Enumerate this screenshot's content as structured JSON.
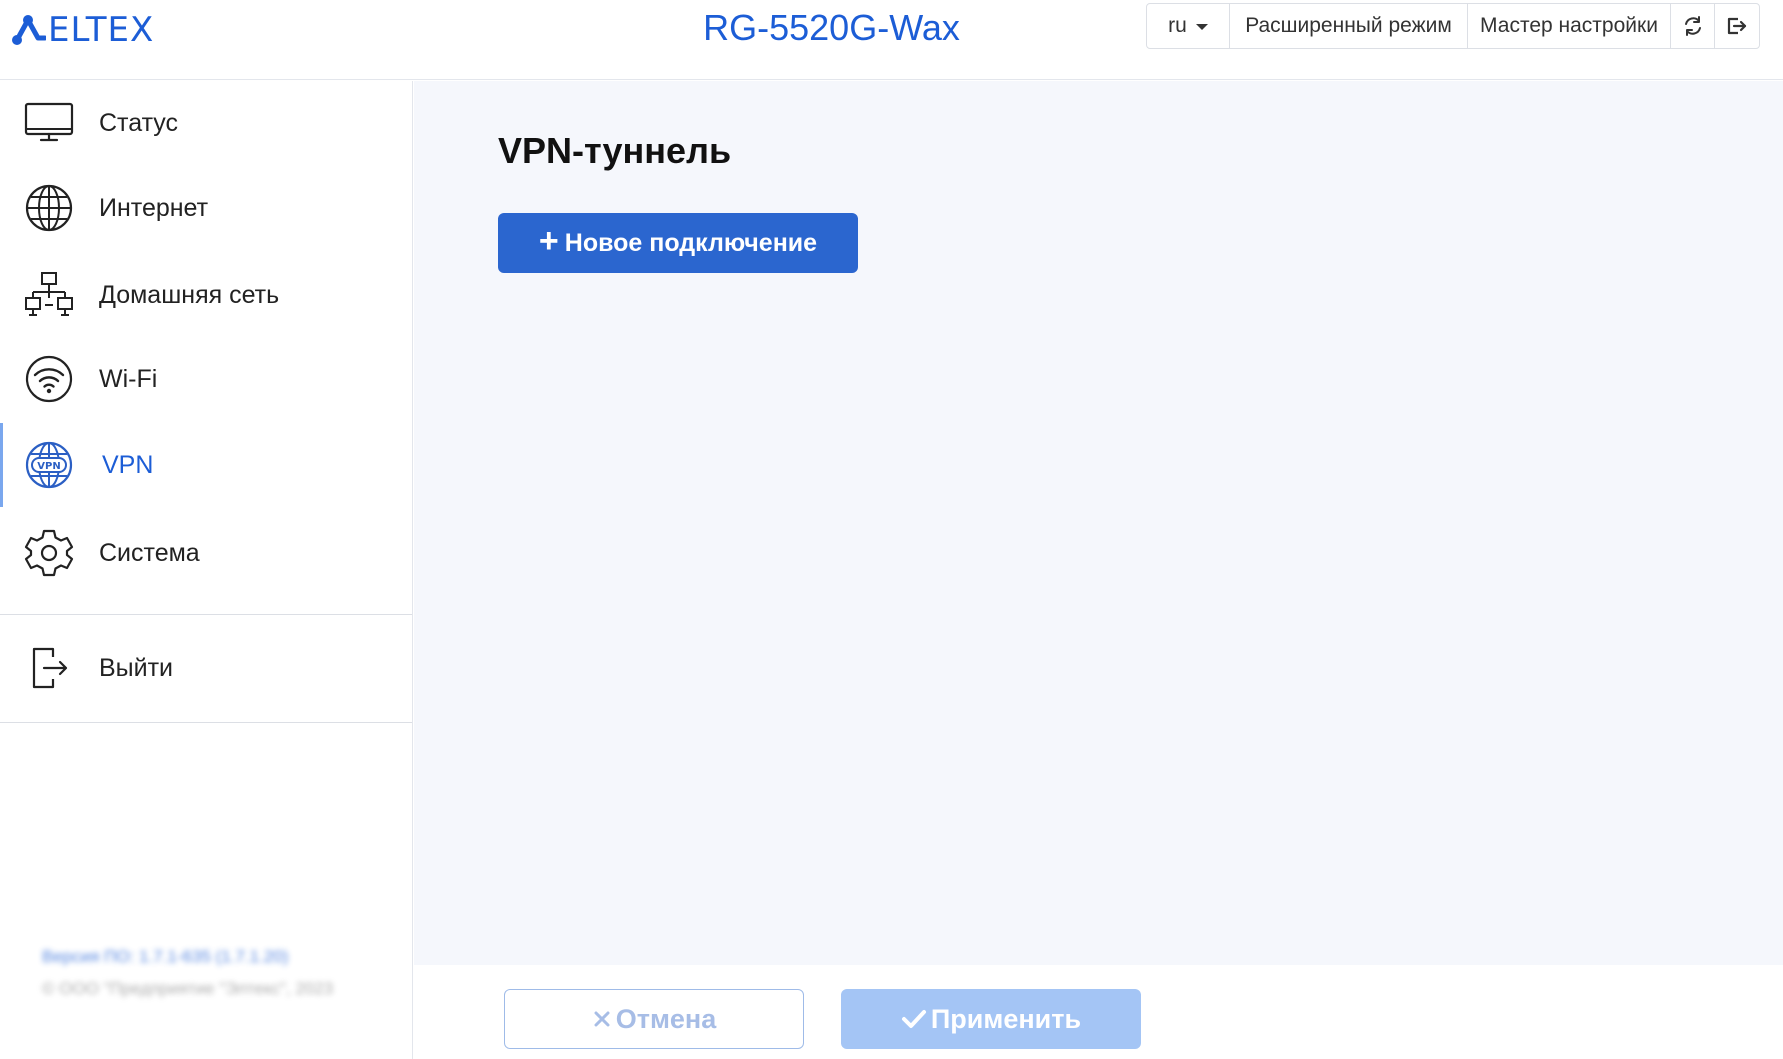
{
  "header": {
    "logo_text": "ELTEX",
    "device_title": "RG-5520G-Wax",
    "language": "ru",
    "advanced_mode_label": "Расширенный режим",
    "wizard_label": "Мастер настройки"
  },
  "sidebar": {
    "items": [
      {
        "label": "Статус",
        "icon": "monitor-icon"
      },
      {
        "label": "Интернет",
        "icon": "globe-icon"
      },
      {
        "label": "Домашняя сеть",
        "icon": "network-icon"
      },
      {
        "label": "Wi-Fi",
        "icon": "wifi-icon"
      },
      {
        "label": "VPN",
        "icon": "vpn-globe-icon",
        "active": true
      },
      {
        "label": "Система",
        "icon": "gear-icon"
      }
    ],
    "logout_label": "Выйти",
    "version_text": "Версия ПО: 1.7.1-635 (1.7.1.20)",
    "copyright_text": "© ООО \"Предприятие \"Элтекс\", 2023"
  },
  "main": {
    "page_title": "VPN-туннель",
    "new_connection_label": "Новое подключение"
  },
  "footer": {
    "cancel_label": "Отмена",
    "apply_label": "Применить"
  },
  "colors": {
    "accent": "#1c5dd6",
    "primary_button": "#2b66cf",
    "apply_disabled": "#a4c5f5",
    "content_bg": "#f5f7fc"
  }
}
